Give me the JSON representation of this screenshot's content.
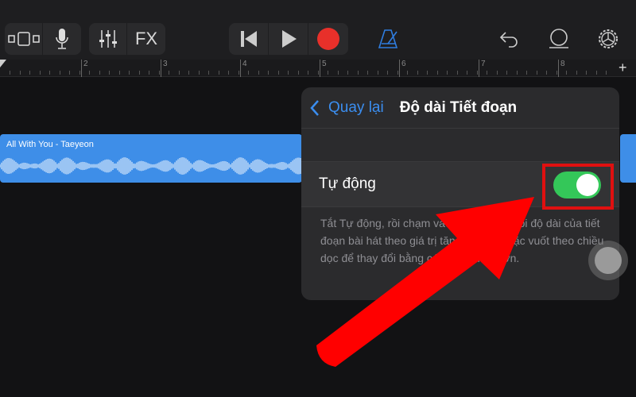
{
  "toolbar": {
    "fx_label": "FX",
    "icons": [
      "tracks-view-icon",
      "microphone-icon",
      "mixer-icon",
      "fx",
      "rewind-icon",
      "play-icon",
      "record-icon",
      "metronome-icon",
      "undo-icon",
      "loop-icon",
      "settings-icon"
    ],
    "record_color": "#e8302a",
    "metronome_color": "#2f7de0"
  },
  "ruler": {
    "markers": [
      "2",
      "3",
      "4",
      "5",
      "6",
      "7",
      "8"
    ],
    "add_label": "+"
  },
  "region": {
    "name": "All With You - Taeyeon",
    "color": "#3e8ee8"
  },
  "popover": {
    "back_label": "Quay lại",
    "title": "Độ dài Tiết đoạn",
    "auto_label": "Tự động",
    "auto_on": true,
    "description": "Tắt Tự động, rồi chạm vào nút để thay đổi độ dài của tiết đoạn bài hát theo giá trị tăng một số hoặc vuốt theo chiều dọc để thay đổi bằng các giá trị lớn hơn."
  },
  "annotation": {
    "color": "#ff0000"
  }
}
